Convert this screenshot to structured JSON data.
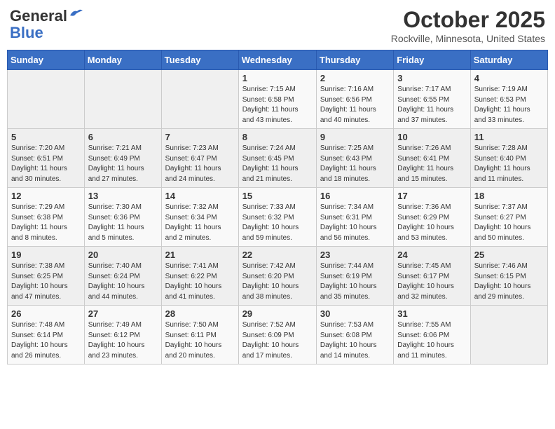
{
  "header": {
    "logo_general": "General",
    "logo_blue": "Blue",
    "month_title": "October 2025",
    "location": "Rockville, Minnesota, United States"
  },
  "days_of_week": [
    "Sunday",
    "Monday",
    "Tuesday",
    "Wednesday",
    "Thursday",
    "Friday",
    "Saturday"
  ],
  "weeks": [
    {
      "cells": [
        {
          "day": "",
          "info": ""
        },
        {
          "day": "",
          "info": ""
        },
        {
          "day": "",
          "info": ""
        },
        {
          "day": "1",
          "info": "Sunrise: 7:15 AM\nSunset: 6:58 PM\nDaylight: 11 hours\nand 43 minutes."
        },
        {
          "day": "2",
          "info": "Sunrise: 7:16 AM\nSunset: 6:56 PM\nDaylight: 11 hours\nand 40 minutes."
        },
        {
          "day": "3",
          "info": "Sunrise: 7:17 AM\nSunset: 6:55 PM\nDaylight: 11 hours\nand 37 minutes."
        },
        {
          "day": "4",
          "info": "Sunrise: 7:19 AM\nSunset: 6:53 PM\nDaylight: 11 hours\nand 33 minutes."
        }
      ]
    },
    {
      "cells": [
        {
          "day": "5",
          "info": "Sunrise: 7:20 AM\nSunset: 6:51 PM\nDaylight: 11 hours\nand 30 minutes."
        },
        {
          "day": "6",
          "info": "Sunrise: 7:21 AM\nSunset: 6:49 PM\nDaylight: 11 hours\nand 27 minutes."
        },
        {
          "day": "7",
          "info": "Sunrise: 7:23 AM\nSunset: 6:47 PM\nDaylight: 11 hours\nand 24 minutes."
        },
        {
          "day": "8",
          "info": "Sunrise: 7:24 AM\nSunset: 6:45 PM\nDaylight: 11 hours\nand 21 minutes."
        },
        {
          "day": "9",
          "info": "Sunrise: 7:25 AM\nSunset: 6:43 PM\nDaylight: 11 hours\nand 18 minutes."
        },
        {
          "day": "10",
          "info": "Sunrise: 7:26 AM\nSunset: 6:41 PM\nDaylight: 11 hours\nand 15 minutes."
        },
        {
          "day": "11",
          "info": "Sunrise: 7:28 AM\nSunset: 6:40 PM\nDaylight: 11 hours\nand 11 minutes."
        }
      ]
    },
    {
      "cells": [
        {
          "day": "12",
          "info": "Sunrise: 7:29 AM\nSunset: 6:38 PM\nDaylight: 11 hours\nand 8 minutes."
        },
        {
          "day": "13",
          "info": "Sunrise: 7:30 AM\nSunset: 6:36 PM\nDaylight: 11 hours\nand 5 minutes."
        },
        {
          "day": "14",
          "info": "Sunrise: 7:32 AM\nSunset: 6:34 PM\nDaylight: 11 hours\nand 2 minutes."
        },
        {
          "day": "15",
          "info": "Sunrise: 7:33 AM\nSunset: 6:32 PM\nDaylight: 10 hours\nand 59 minutes."
        },
        {
          "day": "16",
          "info": "Sunrise: 7:34 AM\nSunset: 6:31 PM\nDaylight: 10 hours\nand 56 minutes."
        },
        {
          "day": "17",
          "info": "Sunrise: 7:36 AM\nSunset: 6:29 PM\nDaylight: 10 hours\nand 53 minutes."
        },
        {
          "day": "18",
          "info": "Sunrise: 7:37 AM\nSunset: 6:27 PM\nDaylight: 10 hours\nand 50 minutes."
        }
      ]
    },
    {
      "cells": [
        {
          "day": "19",
          "info": "Sunrise: 7:38 AM\nSunset: 6:25 PM\nDaylight: 10 hours\nand 47 minutes."
        },
        {
          "day": "20",
          "info": "Sunrise: 7:40 AM\nSunset: 6:24 PM\nDaylight: 10 hours\nand 44 minutes."
        },
        {
          "day": "21",
          "info": "Sunrise: 7:41 AM\nSunset: 6:22 PM\nDaylight: 10 hours\nand 41 minutes."
        },
        {
          "day": "22",
          "info": "Sunrise: 7:42 AM\nSunset: 6:20 PM\nDaylight: 10 hours\nand 38 minutes."
        },
        {
          "day": "23",
          "info": "Sunrise: 7:44 AM\nSunset: 6:19 PM\nDaylight: 10 hours\nand 35 minutes."
        },
        {
          "day": "24",
          "info": "Sunrise: 7:45 AM\nSunset: 6:17 PM\nDaylight: 10 hours\nand 32 minutes."
        },
        {
          "day": "25",
          "info": "Sunrise: 7:46 AM\nSunset: 6:15 PM\nDaylight: 10 hours\nand 29 minutes."
        }
      ]
    },
    {
      "cells": [
        {
          "day": "26",
          "info": "Sunrise: 7:48 AM\nSunset: 6:14 PM\nDaylight: 10 hours\nand 26 minutes."
        },
        {
          "day": "27",
          "info": "Sunrise: 7:49 AM\nSunset: 6:12 PM\nDaylight: 10 hours\nand 23 minutes."
        },
        {
          "day": "28",
          "info": "Sunrise: 7:50 AM\nSunset: 6:11 PM\nDaylight: 10 hours\nand 20 minutes."
        },
        {
          "day": "29",
          "info": "Sunrise: 7:52 AM\nSunset: 6:09 PM\nDaylight: 10 hours\nand 17 minutes."
        },
        {
          "day": "30",
          "info": "Sunrise: 7:53 AM\nSunset: 6:08 PM\nDaylight: 10 hours\nand 14 minutes."
        },
        {
          "day": "31",
          "info": "Sunrise: 7:55 AM\nSunset: 6:06 PM\nDaylight: 10 hours\nand 11 minutes."
        },
        {
          "day": "",
          "info": ""
        }
      ]
    }
  ]
}
